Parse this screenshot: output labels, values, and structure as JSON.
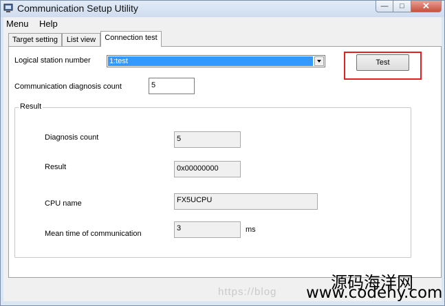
{
  "window": {
    "title": "Communication Setup Utility"
  },
  "menu": {
    "items": [
      "Menu",
      "Help"
    ]
  },
  "tabs": [
    "Target setting",
    "List view",
    "Connection test"
  ],
  "form": {
    "logical_station_label": "Logical station number",
    "logical_station_value": "1:test",
    "diag_count_label": "Communication diagnosis count",
    "diag_count_value": "5",
    "test_button": "Test"
  },
  "result": {
    "group_label": "Result",
    "rows": [
      {
        "label": "Diagnosis count",
        "value": "5"
      },
      {
        "label": "Result",
        "value": "0x00000000"
      },
      {
        "label": "CPU name",
        "value": "FX5UCPU"
      },
      {
        "label": "Mean time of communication",
        "value": "3",
        "unit": "ms"
      }
    ]
  },
  "watermark": {
    "url": "https://blog",
    "cn": "源码海洋网",
    "site": "www.codehy.com"
  },
  "colors": {
    "highlight": "#e02020",
    "selection": "#3399ff"
  }
}
